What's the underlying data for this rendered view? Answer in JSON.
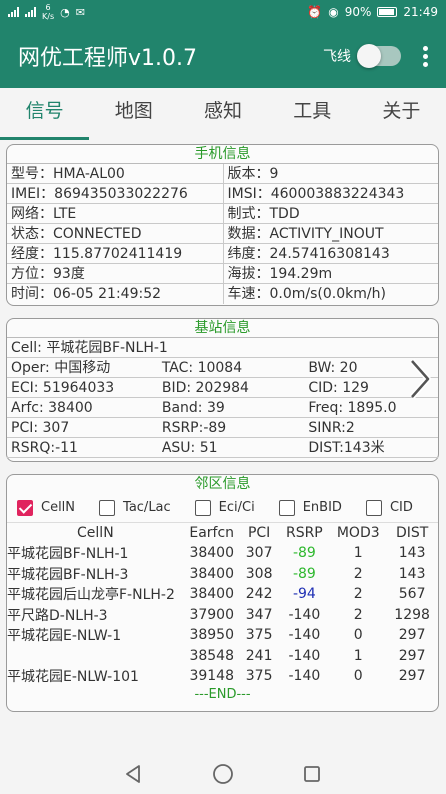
{
  "status_bar": {
    "network_speed": "6\nK/s",
    "battery_percent": "90%",
    "time": "21:49"
  },
  "app_bar": {
    "title": "网优工程师v1.0.7",
    "flight_mode_label": "飞线",
    "flight_mode_on": false
  },
  "tabs": [
    {
      "label": "信号",
      "active": true
    },
    {
      "label": "地图",
      "active": false
    },
    {
      "label": "感知",
      "active": false
    },
    {
      "label": "工具",
      "active": false
    },
    {
      "label": "关于",
      "active": false
    }
  ],
  "phone_info": {
    "title": "手机信息",
    "rows": [
      [
        "型号：HMA-AL00",
        "版本：9"
      ],
      [
        "IMEI：869435033022276",
        "IMSI：460003883224343"
      ],
      [
        "网络：LTE",
        "制式：TDD"
      ],
      [
        "状态：CONNECTED",
        "数据：ACTIVITY_INOUT"
      ],
      [
        "经度：115.87702411419",
        "纬度：24.57416308143"
      ],
      [
        "方位：93度",
        "海拔：194.29m"
      ],
      [
        "时间：06-05 21:49:52",
        "车速：0.0m/s(0.0km/h)"
      ]
    ]
  },
  "cell_info": {
    "title": "基站信息",
    "cell_name": "Cell:  平城花园BF-NLH-1",
    "rows": [
      [
        "Oper: 中国移动",
        "TAC:   10084",
        "BW:   20"
      ],
      [
        "ECI:   51964033",
        "BID:   202984",
        "CID:  129"
      ],
      [
        "Arfc:  38400",
        "Band: 39",
        "Freq: 1895.0"
      ],
      [
        "PCI:   307",
        "RSRP:-89",
        "SINR:2"
      ],
      [
        "RSRQ:-11",
        "ASU:   51",
        "DIST:143米"
      ]
    ]
  },
  "neighbor_info": {
    "title": "邻区信息",
    "filters": [
      {
        "label": "CellN",
        "checked": true
      },
      {
        "label": "Tac/Lac",
        "checked": false
      },
      {
        "label": "Eci/Ci",
        "checked": false
      },
      {
        "label": "EnBID",
        "checked": false
      },
      {
        "label": "CID",
        "checked": false
      }
    ],
    "columns": [
      "CellN",
      "Earfcn",
      "PCI",
      "RSRP",
      "MOD3",
      "DIST"
    ],
    "rows": [
      {
        "cell": "平城花园BF-NLH-1",
        "earfcn": "38400",
        "pci": "307",
        "rsrp": "-89",
        "rsrp_class": "good",
        "mod3": "1",
        "dist": "143"
      },
      {
        "cell": "平城花园BF-NLH-3",
        "earfcn": "38400",
        "pci": "308",
        "rsrp": "-89",
        "rsrp_class": "good",
        "mod3": "2",
        "dist": "143"
      },
      {
        "cell": "平城花园后山龙亭F-NLH-2",
        "earfcn": "38400",
        "pci": "242",
        "rsrp": "-94",
        "rsrp_class": "mid",
        "mod3": "2",
        "dist": "567"
      },
      {
        "cell": "平尺路D-NLH-3",
        "earfcn": "37900",
        "pci": "347",
        "rsrp": "-140",
        "rsrp_class": "",
        "mod3": "2",
        "dist": "1298"
      },
      {
        "cell": "平城花园E-NLW-1",
        "earfcn": "38950",
        "pci": "375",
        "rsrp": "-140",
        "rsrp_class": "",
        "mod3": "0",
        "dist": "297"
      },
      {
        "cell": "",
        "earfcn": "38548",
        "pci": "241",
        "rsrp": "-140",
        "rsrp_class": "",
        "mod3": "1",
        "dist": "297"
      },
      {
        "cell": "平城花园E-NLW-101",
        "earfcn": "39148",
        "pci": "375",
        "rsrp": "-140",
        "rsrp_class": "",
        "mod3": "0",
        "dist": "297"
      }
    ],
    "end_label": "---END---"
  },
  "icons": {
    "signal": "signal-bars-icon",
    "wifi": "wifi-icon",
    "alarm": "alarm-icon",
    "location": "location-icon",
    "battery": "battery-icon",
    "menu": "overflow-menu-icon",
    "next": "chevron-right-icon",
    "back": "nav-back-icon",
    "home": "nav-home-icon",
    "recent": "nav-recent-icon"
  },
  "colors": {
    "primary": "#21846c",
    "section_title": "#2a9a2a",
    "rsrp_good": "#2db82d",
    "rsrp_mid": "#1f2fb4",
    "checkbox": "#e0245e"
  }
}
